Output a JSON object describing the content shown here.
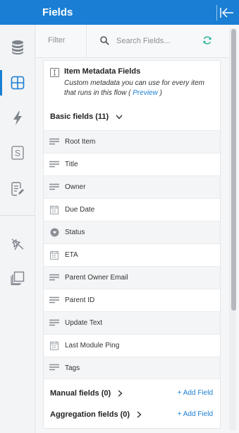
{
  "header": {
    "title": "Fields"
  },
  "rail": {
    "items": [
      {
        "icon": "database-icon",
        "active": false
      },
      {
        "icon": "grid-icon",
        "active": true
      },
      {
        "icon": "lightning-icon",
        "active": false
      },
      {
        "icon": "s-box-icon",
        "active": false
      },
      {
        "icon": "edit-document-icon",
        "active": false
      },
      {
        "icon": "pin-off-icon",
        "active": false
      },
      {
        "icon": "copy-icon",
        "active": false
      }
    ]
  },
  "search": {
    "filter_label": "Filter",
    "placeholder": "Search Fields..."
  },
  "metadata": {
    "title": "Item Metadata Fields",
    "desc_before": "Custom metadata you can use for every item that runs in this flow ( ",
    "preview_link": "Preview",
    "desc_after": " )"
  },
  "basic_fields": {
    "label": "Basic fields (11)",
    "items": [
      {
        "name": "Root Item",
        "icon": "text-lines-icon"
      },
      {
        "name": "Title",
        "icon": "text-lines-icon"
      },
      {
        "name": "Owner",
        "icon": "text-lines-icon"
      },
      {
        "name": "Due Date",
        "icon": "calendar-icon"
      },
      {
        "name": "Status",
        "icon": "dropdown-icon"
      },
      {
        "name": "ETA",
        "icon": "calendar-icon"
      },
      {
        "name": "Parent Owner Email",
        "icon": "text-lines-icon"
      },
      {
        "name": "Parent ID",
        "icon": "text-lines-icon"
      },
      {
        "name": "Update Text",
        "icon": "text-lines-icon"
      },
      {
        "name": "Last Module Ping",
        "icon": "calendar-icon"
      },
      {
        "name": "Tags",
        "icon": "text-lines-icon"
      }
    ]
  },
  "manual_fields": {
    "label": "Manual fields (0)",
    "add_label": "+ Add Field"
  },
  "aggregation_fields": {
    "label": "Aggregation fields (0)",
    "add_label": "+ Add Field"
  },
  "colors": {
    "accent": "#1a7fd4",
    "icon_gray": "#8a9096",
    "rail_icon": "#7d838a"
  }
}
